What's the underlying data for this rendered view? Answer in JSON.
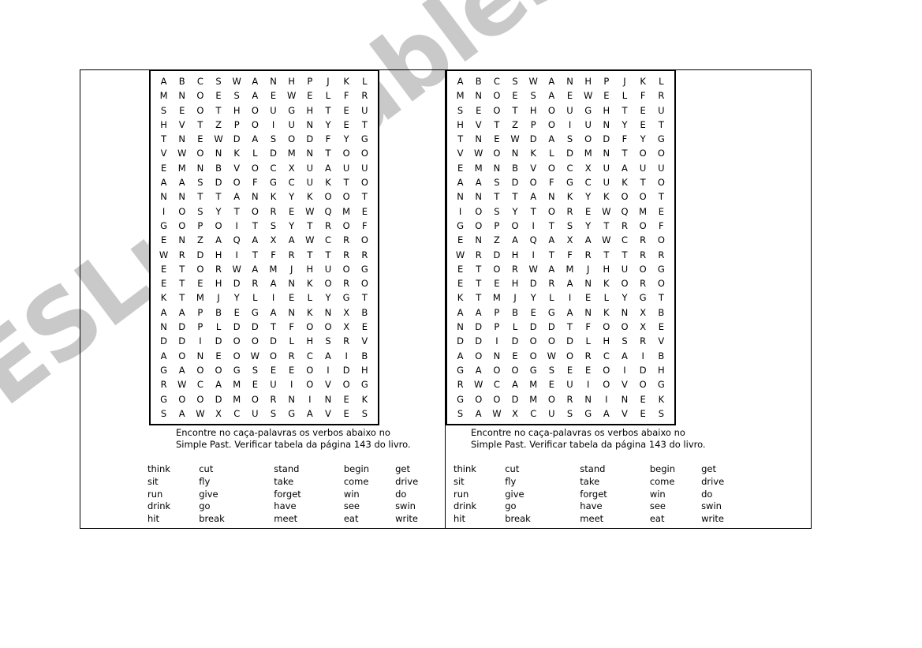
{
  "watermark": {
    "text": "ESLprintables.com"
  },
  "worksheet": {
    "panels": [
      {
        "id": "left",
        "grid": {
          "rows": 24,
          "cols": 12,
          "letters": [
            [
              "A",
              "B",
              "C",
              "S",
              "W",
              "A",
              "N",
              "H",
              "P",
              "J",
              "K",
              "L"
            ],
            [
              "M",
              "N",
              "O",
              "E",
              "S",
              "A",
              "E",
              "W",
              "E",
              "L",
              "F",
              "R"
            ],
            [
              "S",
              "E",
              "O",
              "T",
              "H",
              "O",
              "U",
              "G",
              "H",
              "T",
              "E",
              "U"
            ],
            [
              "H",
              "V",
              "T",
              "Z",
              "P",
              "O",
              "I",
              "U",
              "N",
              "Y",
              "E",
              "T"
            ],
            [
              "T",
              "N",
              "E",
              "W",
              "D",
              "A",
              "S",
              "O",
              "D",
              "F",
              "Y",
              "G"
            ],
            [
              "V",
              "W",
              "O",
              "N",
              "K",
              "L",
              "D",
              "M",
              "N",
              "T",
              "O",
              "O"
            ],
            [
              "E",
              "M",
              "N",
              "B",
              "V",
              "O",
              "C",
              "X",
              "U",
              "A",
              "U",
              "U"
            ],
            [
              "A",
              "A",
              "S",
              "D",
              "O",
              "F",
              "G",
              "C",
              "U",
              "K",
              "T",
              "O"
            ],
            [
              "N",
              "N",
              "T",
              "T",
              "A",
              "N",
              "K",
              "Y",
              "K",
              "O",
              "O",
              "T"
            ],
            [
              "I",
              "O",
              "S",
              "Y",
              "T",
              "O",
              "R",
              "E",
              "W",
              "Q",
              "M",
              "E"
            ],
            [
              "G",
              "O",
              "P",
              "O",
              "I",
              "T",
              "S",
              "Y",
              "T",
              "R",
              "O",
              "F"
            ],
            [
              "E",
              "N",
              "Z",
              "A",
              "Q",
              "A",
              "X",
              "A",
              "W",
              "C",
              "R",
              "O"
            ],
            [
              "W",
              "R",
              "D",
              "H",
              "I",
              "T",
              "F",
              "R",
              "T",
              "T",
              "R",
              "R"
            ],
            [
              "E",
              "T",
              "O",
              "R",
              "W",
              "A",
              "M",
              "J",
              "H",
              "U",
              "O",
              "G"
            ],
            [
              "E",
              "T",
              "E",
              "H",
              "D",
              "R",
              "A",
              "N",
              "K",
              "O",
              "R",
              "O"
            ],
            [
              "K",
              "T",
              "M",
              "J",
              "Y",
              "L",
              "I",
              "E",
              "L",
              "Y",
              "G",
              "T"
            ],
            [
              "A",
              "A",
              "P",
              "B",
              "E",
              "G",
              "A",
              "N",
              "K",
              "N",
              "X",
              "B"
            ],
            [
              "N",
              "D",
              "P",
              "L",
              "D",
              "D",
              "T",
              "F",
              "O",
              "O",
              "X",
              "E"
            ],
            [
              "D",
              "D",
              "I",
              "D",
              "O",
              "O",
              "D",
              "L",
              "H",
              "S",
              "R",
              "V"
            ],
            [
              "A",
              "O",
              "N",
              "E",
              "O",
              "W",
              "O",
              "R",
              "C",
              "A",
              "I",
              "B"
            ],
            [
              "G",
              "A",
              "O",
              "O",
              "G",
              "S",
              "E",
              "E",
              "O",
              "I",
              "D",
              "H"
            ],
            [
              "R",
              "W",
              "C",
              "A",
              "M",
              "E",
              "U",
              "I",
              "O",
              "V",
              "O",
              "G"
            ],
            [
              "G",
              "O",
              "O",
              "D",
              "M",
              "O",
              "R",
              "N",
              "I",
              "N",
              "E",
              "K"
            ],
            [
              "S",
              "A",
              "W",
              "X",
              "C",
              "U",
              "S",
              "G",
              "A",
              "V",
              "E",
              "S"
            ]
          ]
        },
        "instructions": {
          "line1": "Encontre no caça-palavras os verbos abaixo no",
          "line2": "Simple Past. Verificar tabela da página 143 do livro."
        },
        "wordlist": {
          "columns": [
            [
              "think",
              "sit",
              "run",
              "drink",
              "hit"
            ],
            [
              "cut",
              "fly",
              "give",
              "go",
              "break"
            ],
            [
              "stand",
              "take",
              "forget",
              "have",
              "meet"
            ],
            [
              "begin",
              "come",
              "win",
              "see",
              "eat"
            ],
            [
              "get",
              "drive",
              "do",
              "swin",
              "write"
            ]
          ]
        }
      },
      {
        "id": "right",
        "grid": {
          "rows": 24,
          "cols": 12,
          "letters": [
            [
              "A",
              "B",
              "C",
              "S",
              "W",
              "A",
              "N",
              "H",
              "P",
              "J",
              "K",
              "L"
            ],
            [
              "M",
              "N",
              "O",
              "E",
              "S",
              "A",
              "E",
              "W",
              "E",
              "L",
              "F",
              "R"
            ],
            [
              "S",
              "E",
              "O",
              "T",
              "H",
              "O",
              "U",
              "G",
              "H",
              "T",
              "E",
              "U"
            ],
            [
              "H",
              "V",
              "T",
              "Z",
              "P",
              "O",
              "I",
              "U",
              "N",
              "Y",
              "E",
              "T"
            ],
            [
              "T",
              "N",
              "E",
              "W",
              "D",
              "A",
              "S",
              "O",
              "D",
              "F",
              "Y",
              "G"
            ],
            [
              "V",
              "W",
              "O",
              "N",
              "K",
              "L",
              "D",
              "M",
              "N",
              "T",
              "O",
              "O"
            ],
            [
              "E",
              "M",
              "N",
              "B",
              "V",
              "O",
              "C",
              "X",
              "U",
              "A",
              "U",
              "U"
            ],
            [
              "A",
              "A",
              "S",
              "D",
              "O",
              "F",
              "G",
              "C",
              "U",
              "K",
              "T",
              "O"
            ],
            [
              "N",
              "N",
              "T",
              "T",
              "A",
              "N",
              "K",
              "Y",
              "K",
              "O",
              "O",
              "T"
            ],
            [
              "I",
              "O",
              "S",
              "Y",
              "T",
              "O",
              "R",
              "E",
              "W",
              "Q",
              "M",
              "E"
            ],
            [
              "G",
              "O",
              "P",
              "O",
              "I",
              "T",
              "S",
              "Y",
              "T",
              "R",
              "O",
              "F"
            ],
            [
              "E",
              "N",
              "Z",
              "A",
              "Q",
              "A",
              "X",
              "A",
              "W",
              "C",
              "R",
              "O"
            ],
            [
              "W",
              "R",
              "D",
              "H",
              "I",
              "T",
              "F",
              "R",
              "T",
              "T",
              "R",
              "R"
            ],
            [
              "E",
              "T",
              "O",
              "R",
              "W",
              "A",
              "M",
              "J",
              "H",
              "U",
              "O",
              "G"
            ],
            [
              "E",
              "T",
              "E",
              "H",
              "D",
              "R",
              "A",
              "N",
              "K",
              "O",
              "R",
              "O"
            ],
            [
              "K",
              "T",
              "M",
              "J",
              "Y",
              "L",
              "I",
              "E",
              "L",
              "Y",
              "G",
              "T"
            ],
            [
              "A",
              "A",
              "P",
              "B",
              "E",
              "G",
              "A",
              "N",
              "K",
              "N",
              "X",
              "B"
            ],
            [
              "N",
              "D",
              "P",
              "L",
              "D",
              "D",
              "T",
              "F",
              "O",
              "O",
              "X",
              "E"
            ],
            [
              "D",
              "D",
              "I",
              "D",
              "O",
              "O",
              "D",
              "L",
              "H",
              "S",
              "R",
              "V"
            ],
            [
              "A",
              "O",
              "N",
              "E",
              "O",
              "W",
              "O",
              "R",
              "C",
              "A",
              "I",
              "B"
            ],
            [
              "G",
              "A",
              "O",
              "O",
              "G",
              "S",
              "E",
              "E",
              "O",
              "I",
              "D",
              "H"
            ],
            [
              "R",
              "W",
              "C",
              "A",
              "M",
              "E",
              "U",
              "I",
              "O",
              "V",
              "O",
              "G"
            ],
            [
              "G",
              "O",
              "O",
              "D",
              "M",
              "O",
              "R",
              "N",
              "I",
              "N",
              "E",
              "K"
            ],
            [
              "S",
              "A",
              "W",
              "X",
              "C",
              "U",
              "S",
              "G",
              "A",
              "V",
              "E",
              "S"
            ]
          ]
        },
        "instructions": {
          "line1": "Encontre no caça-palavras os verbos abaixo no",
          "line2": "Simple Past. Verificar tabela da página 143 do livro."
        },
        "wordlist": {
          "columns": [
            [
              "think",
              "sit",
              "run",
              "drink",
              "hit"
            ],
            [
              "cut",
              "fly",
              "give",
              "go",
              "break"
            ],
            [
              "stand",
              "take",
              "forget",
              "have",
              "meet"
            ],
            [
              "begin",
              "come",
              "win",
              "see",
              "eat"
            ],
            [
              "get",
              "drive",
              "do",
              "swin",
              "write"
            ]
          ]
        }
      }
    ]
  }
}
